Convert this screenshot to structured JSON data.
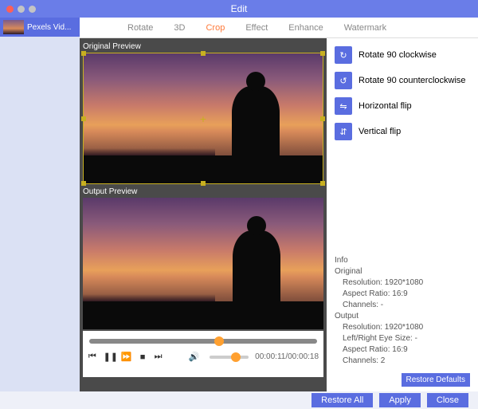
{
  "window": {
    "title": "Edit"
  },
  "sidebar": {
    "items": [
      {
        "label": "Pexels Vid..."
      }
    ]
  },
  "tabs": [
    {
      "label": "Rotate",
      "active": false
    },
    {
      "label": "3D",
      "active": false
    },
    {
      "label": "Crop",
      "active": true
    },
    {
      "label": "Effect",
      "active": false
    },
    {
      "label": "Enhance",
      "active": false
    },
    {
      "label": "Watermark",
      "active": false
    }
  ],
  "previews": {
    "original": "Original Preview",
    "output": "Output Preview"
  },
  "options": [
    {
      "key": "rotate-cw",
      "label": "Rotate 90 clockwise"
    },
    {
      "key": "rotate-ccw",
      "label": "Rotate 90 counterclockwise"
    },
    {
      "key": "hflip",
      "label": "Horizontal flip"
    },
    {
      "key": "vflip",
      "label": "Vertical flip"
    }
  ],
  "playback": {
    "time": "00:00:11/00:00:18"
  },
  "info": {
    "title": "Info",
    "original_label": "Original",
    "original_resolution": "Resolution: 1920*1080",
    "original_aspect": "Aspect Ratio: 16:9",
    "original_channels": "Channels: -",
    "output_label": "Output",
    "output_resolution": "Resolution: 1920*1080",
    "output_eyesize": "Left/Right Eye Size: -",
    "output_aspect": "Aspect Ratio: 16:9",
    "output_channels": "Channels: 2"
  },
  "buttons": {
    "restore_defaults": "Restore Defaults",
    "restore_all": "Restore All",
    "apply": "Apply",
    "close": "Close"
  }
}
